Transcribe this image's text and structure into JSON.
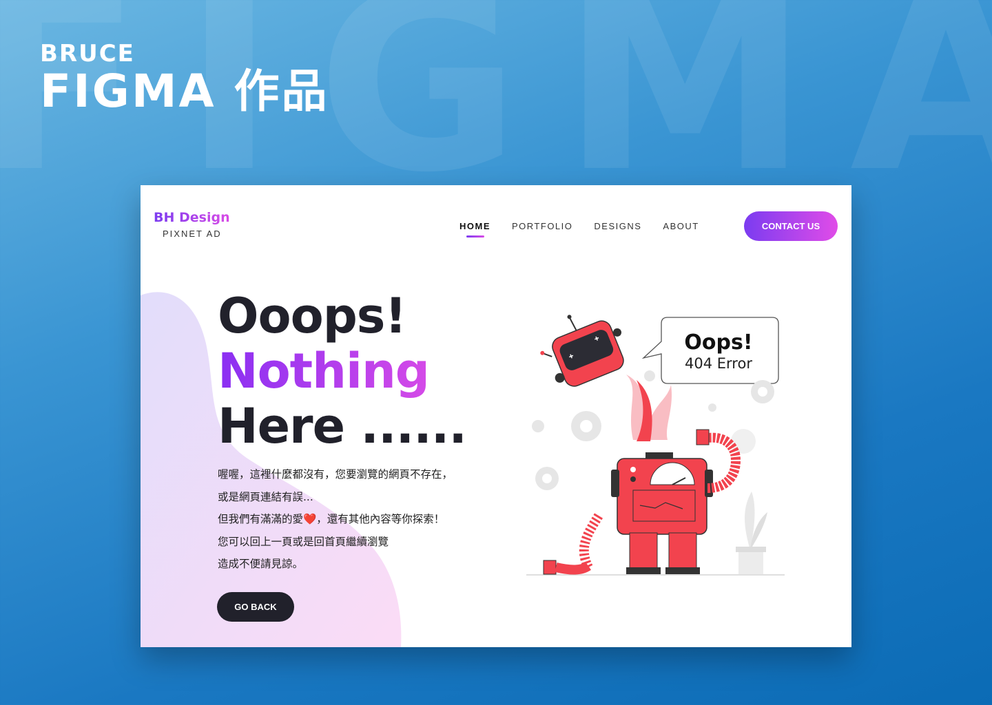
{
  "banner": {
    "watermark": "FIGMA",
    "subtitle": "BRUCE",
    "title": "FIGMA 作品"
  },
  "site": {
    "logo_name": "BH Design",
    "logo_sub": "PIXNET AD",
    "nav": [
      {
        "label": "HOME",
        "active": true
      },
      {
        "label": "PORTFOLIO",
        "active": false
      },
      {
        "label": "DESIGNS",
        "active": false
      },
      {
        "label": "ABOUT",
        "active": false
      }
    ],
    "contact_label": "CONTACT US"
  },
  "hero": {
    "line1": "Ooops!",
    "line2": "Nothing",
    "line3": "Here ......",
    "description": [
      "喔喔，這裡什麼都沒有，您要瀏覽的網頁不存在，",
      "或是網頁連結有誤...",
      "但我們有滿滿的愛❤️，還有其他內容等你探索！",
      "您可以回上一頁或是回首頁繼續瀏覽",
      "造成不便請見諒。"
    ],
    "go_back_label": "GO BACK"
  },
  "illustration": {
    "bubble_title": "Oops!",
    "bubble_sub": "404 Error"
  },
  "colors": {
    "accent_start": "#7b3cf0",
    "accent_end": "#e04ce8",
    "robot_red": "#f2434e",
    "dark": "#21212b"
  }
}
